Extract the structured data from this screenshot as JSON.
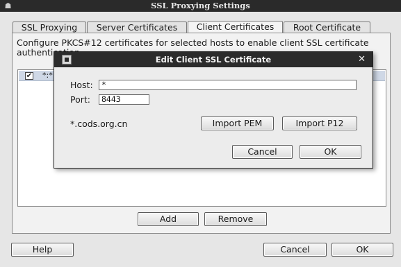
{
  "window": {
    "title": "SSL Proxying Settings"
  },
  "tabs": [
    {
      "label": "SSL Proxying"
    },
    {
      "label": "Server Certificates"
    },
    {
      "label": "Client Certificates",
      "active": true
    },
    {
      "label": "Root Certificate"
    }
  ],
  "main": {
    "description": "Configure PKCS#12 certificates for selected hosts to enable client SSL certificate authentication.",
    "list": [
      {
        "checked": true,
        "host": "*:*"
      }
    ],
    "add_label": "Add",
    "remove_label": "Remove"
  },
  "footer": {
    "help_label": "Help",
    "cancel_label": "Cancel",
    "ok_label": "OK"
  },
  "dialog": {
    "title": "Edit Client SSL Certificate",
    "close_glyph": "✕",
    "host_label": "Host:",
    "host_value": "*",
    "port_label": "Port:",
    "port_value": "8443",
    "cert_name": "*.cods.org.cn",
    "import_pem_label": "Import PEM",
    "import_p12_label": "Import P12",
    "cancel_label": "Cancel",
    "ok_label": "OK"
  },
  "icons": {
    "app": "bug-icon",
    "dialog": "app-icon",
    "close": "close-icon",
    "check": "check-icon"
  }
}
